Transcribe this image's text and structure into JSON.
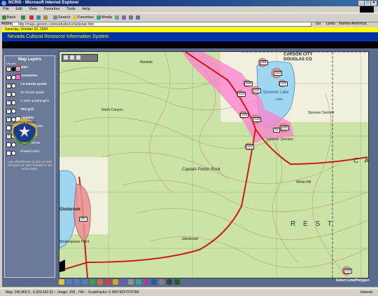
{
  "window": {
    "title": "NCRIS - Microsoft Internet Explorer",
    "controls": [
      "_",
      "□",
      "×"
    ]
  },
  "menu": [
    "File",
    "Edit",
    "View",
    "Favorites",
    "Tools",
    "Help"
  ],
  "toolbar": {
    "back": "Back",
    "search": "Search",
    "favorites": "Favorites",
    "media": "Media"
  },
  "address": {
    "label": "Address",
    "url": "http://maps.gisinon.com/website/ncris/viewer.htm",
    "go": "Go",
    "links": "Links",
    "norton": "Norton AntiVirus"
  },
  "date_text": "Saturday, October 02, 2004",
  "banner_title": "Nevada Cultural Resource Information System",
  "panel": {
    "header": "Map Layers",
    "subheader": "Vis Actv",
    "layers": [
      {
        "label": "Sites",
        "bold": true,
        "visible": true,
        "active": true,
        "swatch": "#ff9999"
      },
      {
        "label": "Inventories",
        "bold": true,
        "visible": true,
        "active": false,
        "swatch": "#ff66cc"
      },
      {
        "label": "7.5 minute quads",
        "bold": true,
        "visible": true,
        "active": false,
        "swatch": ""
      },
      {
        "label": "15 minute quads",
        "bold": false,
        "visible": true,
        "active": false,
        "swatch": ""
      },
      {
        "label": "1:100K quadrangles",
        "bold": false,
        "visible": true,
        "active": false,
        "swatch": ""
      },
      {
        "label": "TRS grid",
        "bold": true,
        "visible": true,
        "active": false,
        "swatch": ""
      },
      {
        "label": "Counties",
        "bold": true,
        "visible": true,
        "active": false,
        "swatch": "#ffffff"
      },
      {
        "label": "Hydrologic units",
        "bold": false,
        "visible": false,
        "active": false,
        "swatch": ""
      },
      {
        "label": "7.5m DRGs",
        "bold": true,
        "visible": true,
        "active": false,
        "swatch": ""
      },
      {
        "label": "1:100K DRGs",
        "bold": false,
        "visible": false,
        "active": false,
        "swatch": ""
      },
      {
        "label": "Shaded relief",
        "bold": false,
        "visible": false,
        "active": false,
        "swatch": ""
      }
    ],
    "hint": "Use checkboxes to turn on and off layers or radio buttons to set active layer",
    "seal_motto": "BATTLE BORN"
  },
  "map_labels": {
    "carson_city": "CARSON CITY",
    "douglas_co": "DOUGLAS CO",
    "spooner_lake": "Spooner Lake",
    "spooner_summit": "Spooner Summit",
    "spooner_junction": "Spooner Junction",
    "captain_pomin_rock": "Captain Pomin Rock",
    "white_hill": "White Hill",
    "glenbrook": "Glenbrook",
    "glenbrook_creek": "Glenbrook",
    "north_canyon": "North Canyon",
    "rest": "R E S T",
    "c_a": "C A",
    "lake_label": "Lake",
    "marlette": "Marlette",
    "shakespeare_point": "Shakespeare Point",
    "hwy_50": "50",
    "site_labels": [
      "000",
      "003",
      "004",
      "011",
      "013",
      "016",
      "019",
      "020",
      "022",
      "025",
      "029",
      "057"
    ]
  },
  "status": {
    "text": "Map: 246,960.9 , 4,320,642.52 -- Image: 209 , 740 -- ScaleFactor: 6.39674237276789",
    "zone": "Internet",
    "select_label": "Select Line/Polygon"
  },
  "colors": {
    "banner_bg": "#0033aa",
    "banner_fg": "#ffff00",
    "date_bg": "#ffff00",
    "panel_bg": "#6b7a99",
    "site": "#e06060",
    "road": "#cc0000"
  }
}
